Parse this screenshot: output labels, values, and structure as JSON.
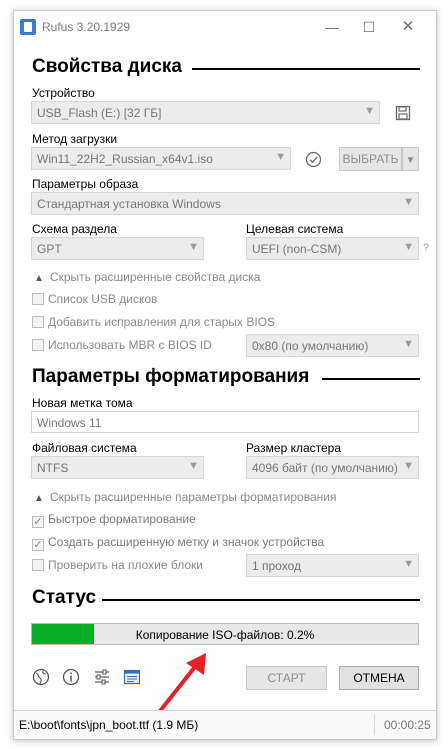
{
  "window": {
    "title": "Rufus 3.20.1929",
    "minimize": "—",
    "maximize": "☐",
    "close": "✕"
  },
  "drive": {
    "heading": "Свойства диска",
    "device_label": "Устройство",
    "device_value": "USB_Flash (E:) [32 ГБ]",
    "boot_label": "Метод загрузки",
    "boot_value": "Win11_22H2_Russian_x64v1.iso",
    "select_button": "ВЫБРАТЬ",
    "image_label": "Параметры образа",
    "image_value": "Стандартная установка Windows",
    "partition_label": "Схема раздела",
    "partition_value": "GPT",
    "target_label": "Целевая система",
    "target_value": "UEFI (non-CSM)",
    "help_mark": "?",
    "advanced_toggle": "Скрыть расширенные свойства диска",
    "list_usb": "Список USB дисков",
    "old_bios_fixes": "Добавить исправления для старых BIOS",
    "use_mbr": "Использовать MBR с BIOS ID",
    "bios_id_value": "0x80 (по умолчанию)"
  },
  "format": {
    "heading": "Параметры форматирования",
    "volume_label": "Новая метка тома",
    "volume_value": "Windows 11",
    "fs_label": "Файловая система",
    "fs_value": "NTFS",
    "cluster_label": "Размер кластера",
    "cluster_value": "4096 байт (по умолчанию)",
    "advanced_toggle": "Скрыть расширенные параметры форматирования",
    "quick_format": "Быстрое форматирование",
    "extended_label": "Создать расширенную метку и значок устройства",
    "check_bad_blocks": "Проверить на плохие блоки",
    "passes_value": "1 проход"
  },
  "status": {
    "heading": "Статус",
    "progress_text": "Копирование ISO-файлов: 0.2%",
    "progress_fraction": 0.16,
    "start_button": "СТАРТ",
    "cancel_button": "ОТМЕНА"
  },
  "statusbar": {
    "file": "E:\\boot\\fonts\\jpn_boot.ttf (1.9 МБ)",
    "timer": "00:00:25"
  },
  "icons": [
    "globe-icon",
    "info-icon",
    "settings-sliders-icon",
    "log-icon",
    "save-icon",
    "check-circle-icon",
    "chevron-up-icon"
  ],
  "colors": {
    "progress": "#06b025",
    "annotation_arrow": "#e8202a"
  }
}
